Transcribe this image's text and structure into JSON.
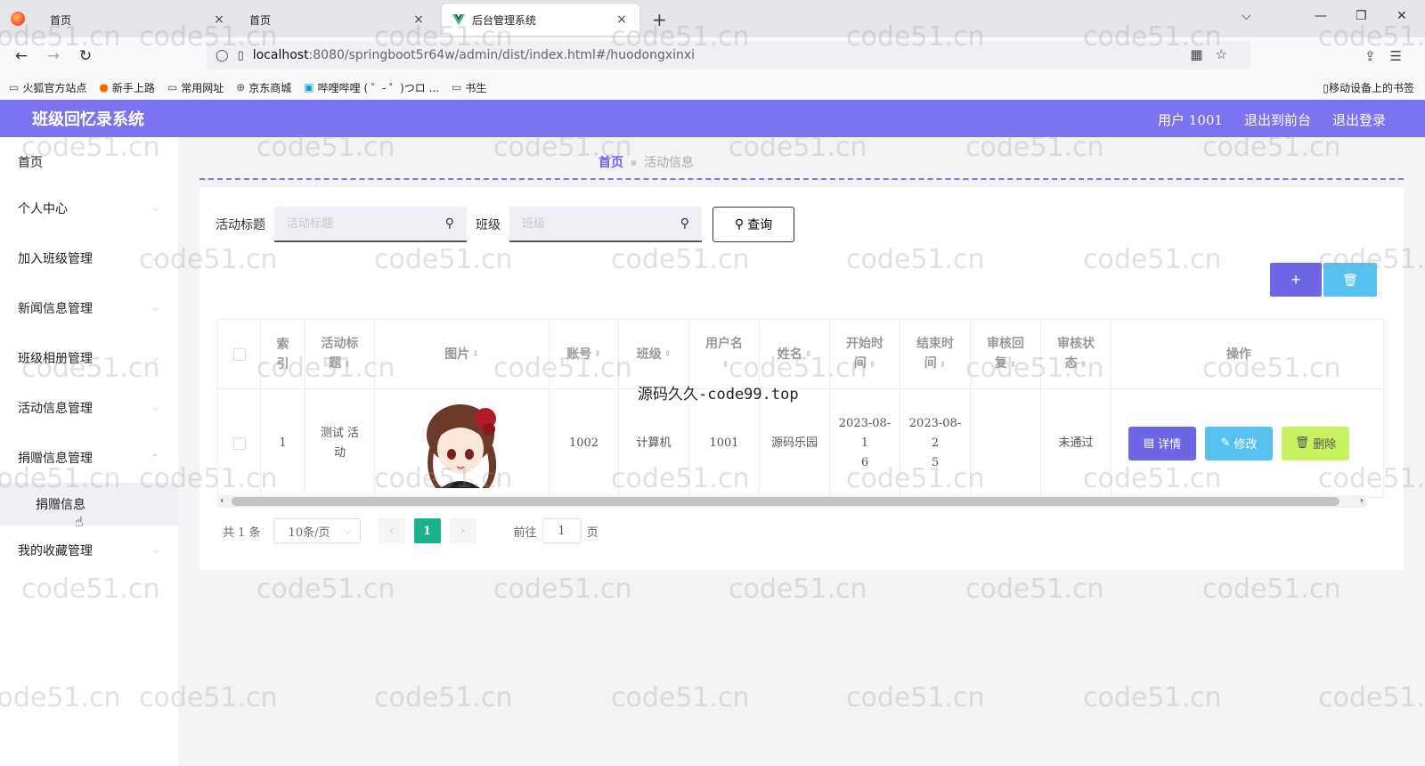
{
  "browser": {
    "tabs": [
      {
        "title": "首页",
        "close": "×"
      },
      {
        "title": "首页",
        "close": "×"
      },
      {
        "title": "后台管理系统",
        "close": "×"
      }
    ],
    "new_tab": "+",
    "url_host": "localhost",
    "url_rest": ":8080/springboot5r64w/admin/dist/index.html#/huodongxinxi",
    "bookmarks": [
      "火狐官方站点",
      "新手上路",
      "常用网址",
      "京东商城",
      "哔哩哔哩 ( ゜- ゜)つロ ...",
      "书生"
    ],
    "mobile_bookmarks": "移动设备上的书签"
  },
  "header": {
    "title": "班级回忆录系统",
    "user": "用户 1001",
    "to_front": "退出到前台",
    "logout": "退出登录"
  },
  "sidebar": {
    "items": [
      {
        "label": "首页"
      },
      {
        "label": "个人中心"
      },
      {
        "label": "加入班级管理"
      },
      {
        "label": "新闻信息管理"
      },
      {
        "label": "班级相册管理"
      },
      {
        "label": "活动信息管理"
      },
      {
        "label": "捐赠信息管理"
      },
      {
        "label": "捐赠信息"
      },
      {
        "label": "我的收藏管理"
      }
    ]
  },
  "breadcrumb": {
    "home": "首页",
    "current": "活动信息"
  },
  "search": {
    "title_label": "活动标题",
    "title_placeholder": "活动标题",
    "class_label": "班级",
    "class_placeholder": "班级",
    "query_button": "查询"
  },
  "table": {
    "headers": {
      "index": [
        "索",
        "引"
      ],
      "title": [
        "活动标",
        "题"
      ],
      "image": "图片",
      "account": "账号",
      "class": "班级",
      "username": "用户名",
      "name": "姓名",
      "start": [
        "开始时",
        "间"
      ],
      "end": [
        "结束时",
        "间"
      ],
      "reply": [
        "审核回",
        "复"
      ],
      "status": [
        "审核状",
        "态"
      ],
      "ops": "操作"
    },
    "rows": [
      {
        "index": "1",
        "title": [
          "测试 活",
          "动"
        ],
        "account": "1002",
        "class": "计算机",
        "username": "1001",
        "name": "源码乐园",
        "start": [
          "2023-08-1",
          "6"
        ],
        "end": [
          "2023-08-2",
          "5"
        ],
        "reply": "",
        "status": "未通过",
        "detail": "详情",
        "edit": "修改",
        "delete": "删除"
      }
    ]
  },
  "pagination": {
    "total": "共 1 条",
    "page_size": "10条/页",
    "current_page": "1",
    "goto_label": "前往",
    "goto_value": "1",
    "page_suffix": "页"
  },
  "overlay": "源码久久-code99.top",
  "watermark": "code51.cn",
  "colors": {
    "header": "#7c73f0",
    "primary": "#6e66e4",
    "info": "#57c2f0",
    "danger": "#c9f260",
    "page_active": "#19b28d"
  }
}
